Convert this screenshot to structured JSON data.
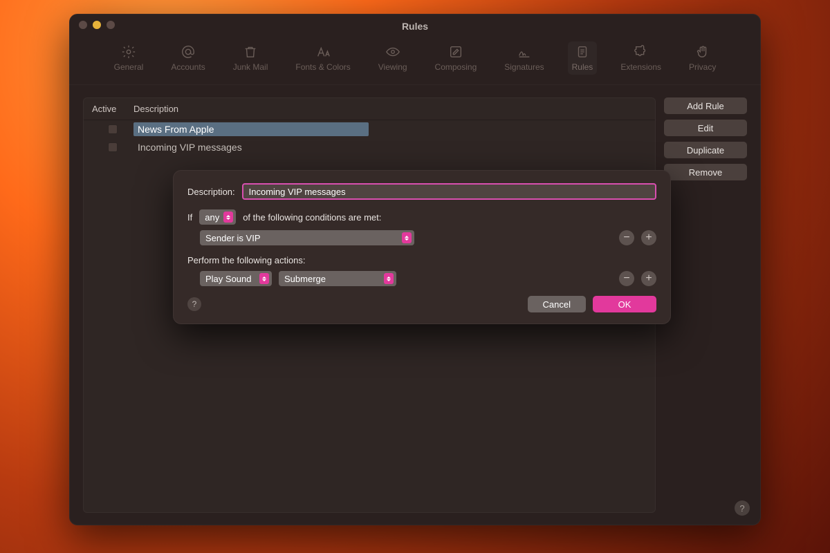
{
  "window": {
    "title": "Rules"
  },
  "toolbar": {
    "items": [
      {
        "label": "General"
      },
      {
        "label": "Accounts"
      },
      {
        "label": "Junk Mail"
      },
      {
        "label": "Fonts & Colors"
      },
      {
        "label": "Viewing"
      },
      {
        "label": "Composing"
      },
      {
        "label": "Signatures"
      },
      {
        "label": "Rules"
      },
      {
        "label": "Extensions"
      },
      {
        "label": "Privacy"
      }
    ]
  },
  "list": {
    "col_active": "Active",
    "col_desc": "Description",
    "rows": [
      {
        "desc": "News From Apple"
      },
      {
        "desc": "Incoming VIP messages"
      }
    ]
  },
  "side": {
    "add": "Add Rule",
    "edit": "Edit",
    "duplicate": "Duplicate",
    "remove": "Remove"
  },
  "sheet": {
    "desc_label": "Description:",
    "desc_value": "Incoming VIP messages",
    "if_prefix": "If",
    "if_mode": "any",
    "if_suffix": "of the following conditions are met:",
    "condition": "Sender is VIP",
    "actions_label": "Perform the following actions:",
    "action_type": "Play Sound",
    "action_value": "Submerge",
    "cancel": "Cancel",
    "ok": "OK",
    "help": "?"
  }
}
